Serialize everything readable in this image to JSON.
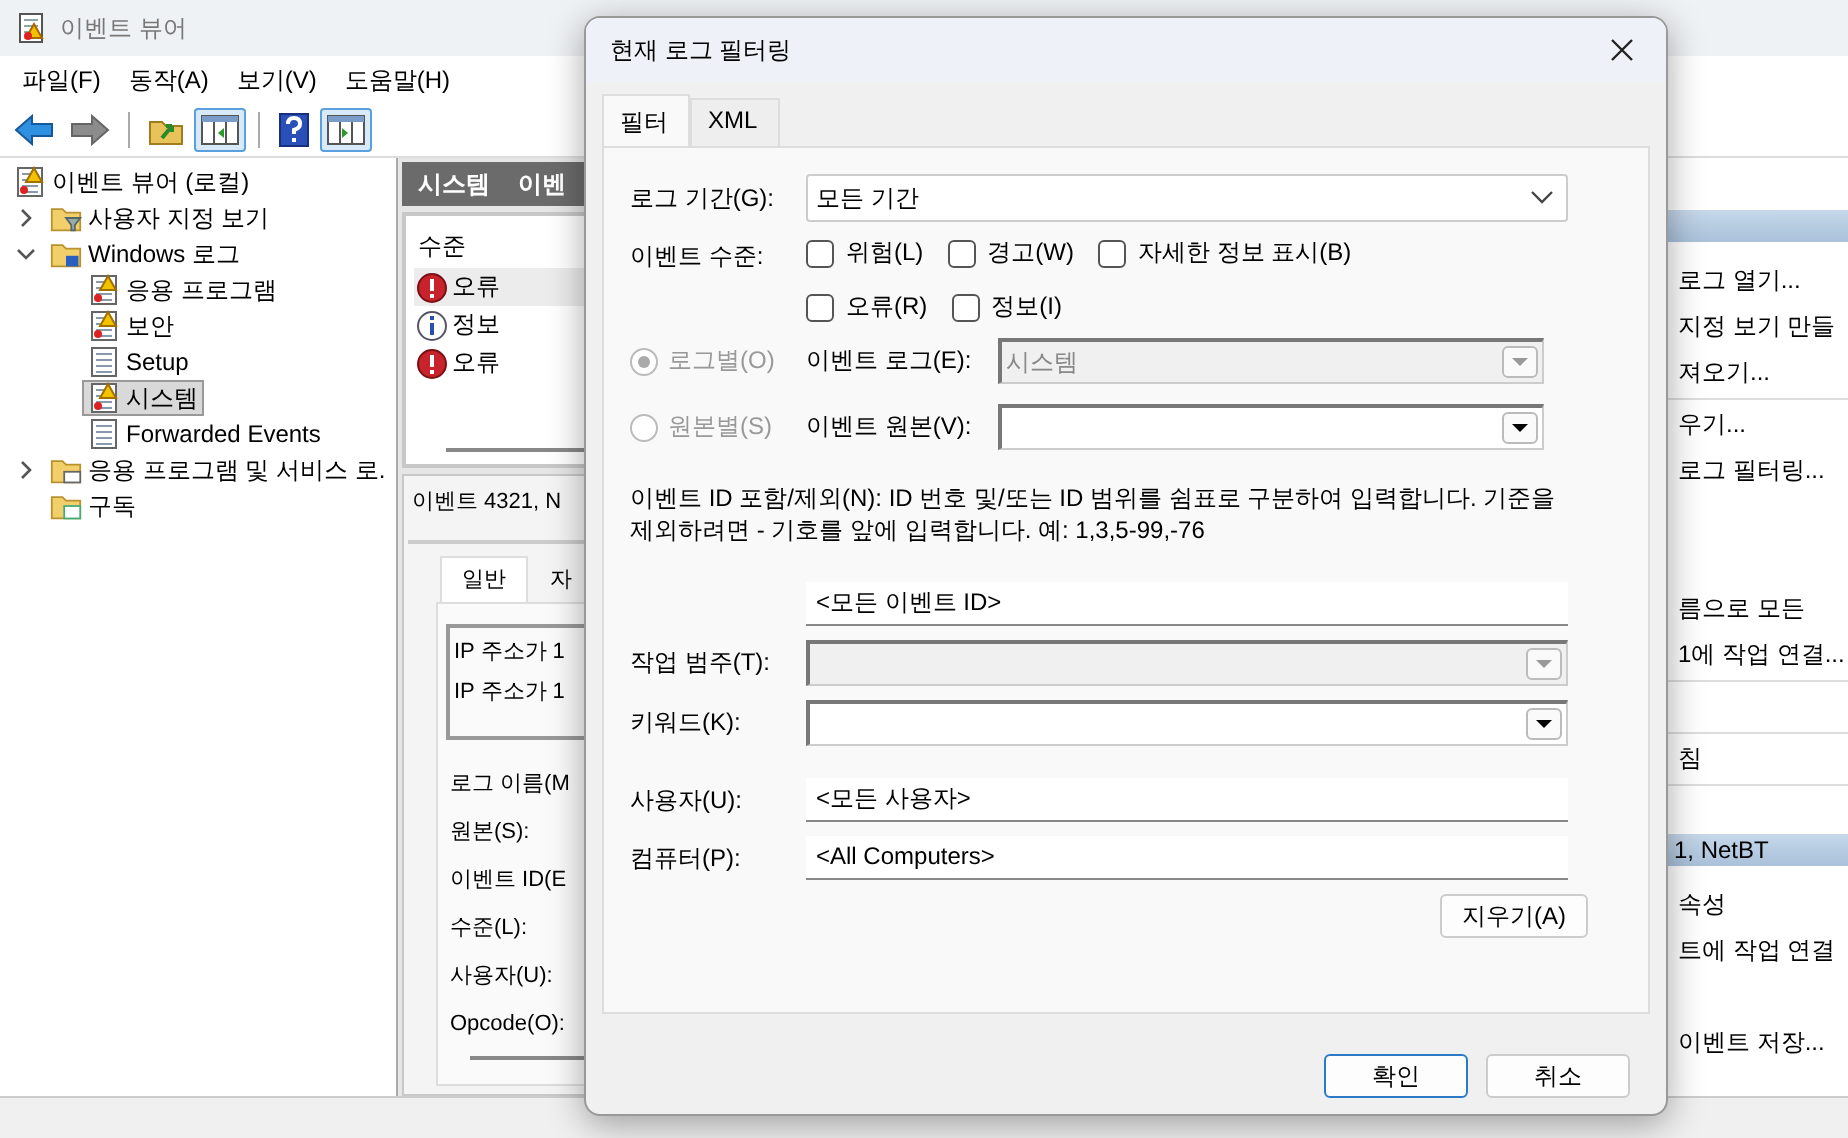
{
  "app": {
    "title": "이벤트 뷰어",
    "menu": [
      "파일(F)",
      "동작(A)",
      "보기(V)",
      "도움말(H)"
    ],
    "toolbar": [
      {
        "kind": "back",
        "pressed": false
      },
      {
        "kind": "forward",
        "pressed": false
      },
      {
        "kind": "separator"
      },
      {
        "kind": "up",
        "pressed": false
      },
      {
        "kind": "pane-left",
        "pressed": true
      },
      {
        "kind": "separator"
      },
      {
        "kind": "help",
        "pressed": false
      },
      {
        "kind": "pane-right",
        "pressed": true
      }
    ]
  },
  "tree": [
    {
      "label": "이벤트 뷰어 (로컬)",
      "kind": "viewer",
      "selected": false,
      "children": [
        {
          "label": "사용자 지정 보기",
          "kind": "folder-filter",
          "expanded": false,
          "selected": false
        },
        {
          "label": "Windows 로그",
          "kind": "folder-windows",
          "expanded": true,
          "selected": false,
          "children": [
            {
              "label": "응용 프로그램",
              "kind": "log-warn",
              "selected": false
            },
            {
              "label": "보안",
              "kind": "log-warn",
              "selected": false
            },
            {
              "label": "Setup",
              "kind": "log",
              "selected": false
            },
            {
              "label": "시스템",
              "kind": "log-warn",
              "selected": true
            },
            {
              "label": "Forwarded Events",
              "kind": "log",
              "selected": false
            }
          ]
        },
        {
          "label": "응용 프로그램 및 서비스 로.",
          "kind": "folder-app",
          "expanded": false,
          "selected": false
        },
        {
          "label": "구독",
          "kind": "folder-sub",
          "selected": false
        }
      ]
    }
  ],
  "middle": {
    "header": [
      "시스템",
      "이벤"
    ],
    "list_header": "수준",
    "events": [
      {
        "kind": "error",
        "label": "오류",
        "selected": true
      },
      {
        "kind": "info",
        "label": "정보",
        "selected": false
      },
      {
        "kind": "error",
        "label": "오류",
        "selected": false
      }
    ],
    "detail_title": "이벤트 4321, N",
    "detail_tabs": [
      {
        "label": "일반",
        "selected": true
      },
      {
        "label": "자",
        "selected": false
      }
    ],
    "message_lines": [
      "IP 주소가 1",
      "IP 주소가 1"
    ],
    "fields": [
      "로그 이름(M",
      "원본(S):",
      "이벤트 ID(E",
      "수준(L):",
      "사용자(U):",
      "Opcode(O):"
    ]
  },
  "actions": [
    {
      "kind": "header"
    },
    {
      "kind": "item",
      "label": "로그 열기..."
    },
    {
      "kind": "item",
      "label": "지정 보기 만들"
    },
    {
      "kind": "item",
      "label": "져오기..."
    },
    {
      "kind": "separator"
    },
    {
      "kind": "item",
      "label": "우기..."
    },
    {
      "kind": "item",
      "label": "로그 필터링..."
    },
    {
      "kind": "blank"
    },
    {
      "kind": "blank"
    },
    {
      "kind": "item",
      "label": "름으로 모든"
    },
    {
      "kind": "item",
      "label": "1에 작업 연결..."
    },
    {
      "kind": "separator"
    },
    {
      "kind": "blank"
    },
    {
      "kind": "separator"
    },
    {
      "kind": "item",
      "label": "침"
    },
    {
      "kind": "separator"
    },
    {
      "kind": "blank"
    },
    {
      "kind": "header",
      "label": "1, NetBT"
    },
    {
      "kind": "item",
      "label": "속성"
    },
    {
      "kind": "item",
      "label": "트에 작업 연결"
    },
    {
      "kind": "blank"
    },
    {
      "kind": "item",
      "label": "이벤트 저장..."
    }
  ],
  "dialog": {
    "title": "현재 로그 필터링",
    "tabs": [
      {
        "label": "필터",
        "selected": true
      },
      {
        "label": "XML",
        "selected": false
      }
    ],
    "period_label": "로그 기간(G):",
    "period_value": "모든 기간",
    "level_label": "이벤트 수준:",
    "level_rows": [
      [
        {
          "label": "위험(L)",
          "checked": false
        },
        {
          "label": "경고(W)",
          "checked": false
        },
        {
          "label": "자세한 정보 표시(B)",
          "checked": false
        }
      ],
      [
        {
          "label": "오류(R)",
          "checked": false
        },
        {
          "label": "정보(I)",
          "checked": false
        }
      ]
    ],
    "scope": [
      {
        "label": "로그별(O)",
        "selected": true,
        "disabled": true,
        "field_label": "이벤트 로그(E):",
        "value": "시스템",
        "field_disabled": true
      },
      {
        "label": "원본별(S)",
        "selected": false,
        "disabled": true,
        "field_label": "이벤트 원본(V):",
        "field_disabled": false
      }
    ],
    "id_description": "이벤트 ID 포함/제외(N): ID 번호 및/또는 ID 범위를 쉼표로 구분하여 입력합니다. 기준을 제외하려면 - 기호를 앞에 입력합니다. 예: 1,3,5-99,-76",
    "event_id_value": "<모든 이벤트 ID>",
    "task_label": "작업 범주(T):",
    "task_disabled": true,
    "keyword_label": "키워드(K):",
    "user_label": "사용자(U):",
    "user_value": "<모든 사용자>",
    "computer_label": "컴퓨터(P):",
    "computer_value": "<All Computers>",
    "clear_button": "지우기(A)",
    "buttons": [
      {
        "label": "확인",
        "default": true
      },
      {
        "label": "취소",
        "default": false
      }
    ]
  }
}
